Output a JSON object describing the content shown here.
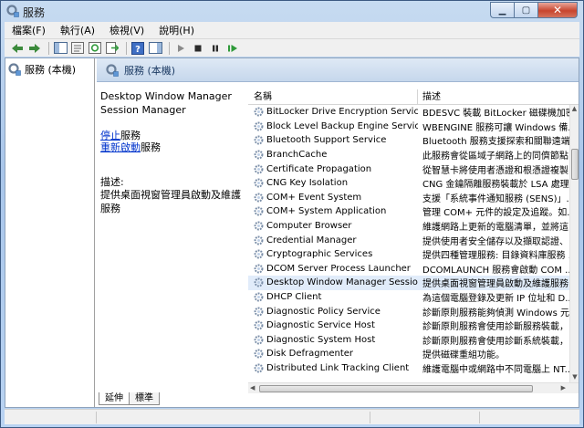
{
  "window": {
    "title": "服務",
    "minimize_glyph": "▁",
    "maximize_glyph": "▢",
    "close_glyph": "✕"
  },
  "menu": [
    "檔案(F)",
    "執行(A)",
    "檢視(V)",
    "說明(H)"
  ],
  "toolbar": {
    "icons": [
      "back-icon",
      "forward-icon",
      "show-hide-tree-icon",
      "properties-icon",
      "refresh-icon",
      "export-list-icon",
      "help-icon",
      "show-hide-action-pane-icon",
      "play-icon",
      "stop-icon",
      "pause-icon",
      "restart-icon"
    ]
  },
  "tree": {
    "root_label": "服務 (本機)"
  },
  "pane": {
    "header": "服務 (本機)"
  },
  "details": {
    "service_name": "Desktop Window Manager Session Manager",
    "stop_link": "停止",
    "stop_suffix": "服務",
    "restart_link": "重新啟動",
    "restart_suffix": "服務",
    "description_label": "描述:",
    "description_text": "提供桌面視窗管理員啟動及維護服務"
  },
  "list": {
    "columns": {
      "name": "名稱",
      "description": "描述"
    },
    "selected_index": 13,
    "rows": [
      {
        "name": "BitLocker Drive Encryption Service",
        "description": "BDESVC 裝載 BitLocker 磁碟機加密..."
      },
      {
        "name": "Block Level Backup Engine Service",
        "description": "WBENGINE 服務可讓 Windows 備..."
      },
      {
        "name": "Bluetooth Support Service",
        "description": "Bluetooth 服務支援探索和關聯遠端..."
      },
      {
        "name": "BranchCache",
        "description": "此服務會從區域子網路上的同儕節點..."
      },
      {
        "name": "Certificate Propagation",
        "description": "從智慧卡將使用者憑證和根憑證複製..."
      },
      {
        "name": "CNG Key Isolation",
        "description": "CNG 金鑰隔離服務裝載於 LSA 處理..."
      },
      {
        "name": "COM+ Event System",
        "description": "支援「系統事件通知服務 (SENS)」..."
      },
      {
        "name": "COM+ System Application",
        "description": "管理 COM+ 元件的設定及追蹤。如..."
      },
      {
        "name": "Computer Browser",
        "description": "維護網路上更新的電腦清單，並將這..."
      },
      {
        "name": "Credential Manager",
        "description": "提供使用者安全儲存以及擷取認證、..."
      },
      {
        "name": "Cryptographic Services",
        "description": "提供四種管理服務: 目錄資料庫服務 ..."
      },
      {
        "name": "DCOM Server Process Launcher",
        "description": "DCOMLAUNCH 服務會啟動 COM ..."
      },
      {
        "name": "Desktop Window Manager Session ...",
        "description": "提供桌面視窗管理員啟動及維護服務"
      },
      {
        "name": "DHCP Client",
        "description": "為這個電腦登錄及更新 IP 位址和 D..."
      },
      {
        "name": "Diagnostic Policy Service",
        "description": "診斷原則服務能夠偵測 Windows 元..."
      },
      {
        "name": "Diagnostic Service Host",
        "description": "診斷原則服務會使用診斷服務裝載，..."
      },
      {
        "name": "Diagnostic System Host",
        "description": "診斷原則服務會使用診斷系統裝載，..."
      },
      {
        "name": "Disk Defragmenter",
        "description": "提供磁碟重組功能。"
      },
      {
        "name": "Distributed Link Tracking Client",
        "description": "維護電腦中或網路中不同電腦上 NT..."
      }
    ]
  },
  "scroll": {
    "up": "▲",
    "down": "▼",
    "left": "◀",
    "right": "▶"
  },
  "tabs": [
    "延伸",
    "標準"
  ]
}
